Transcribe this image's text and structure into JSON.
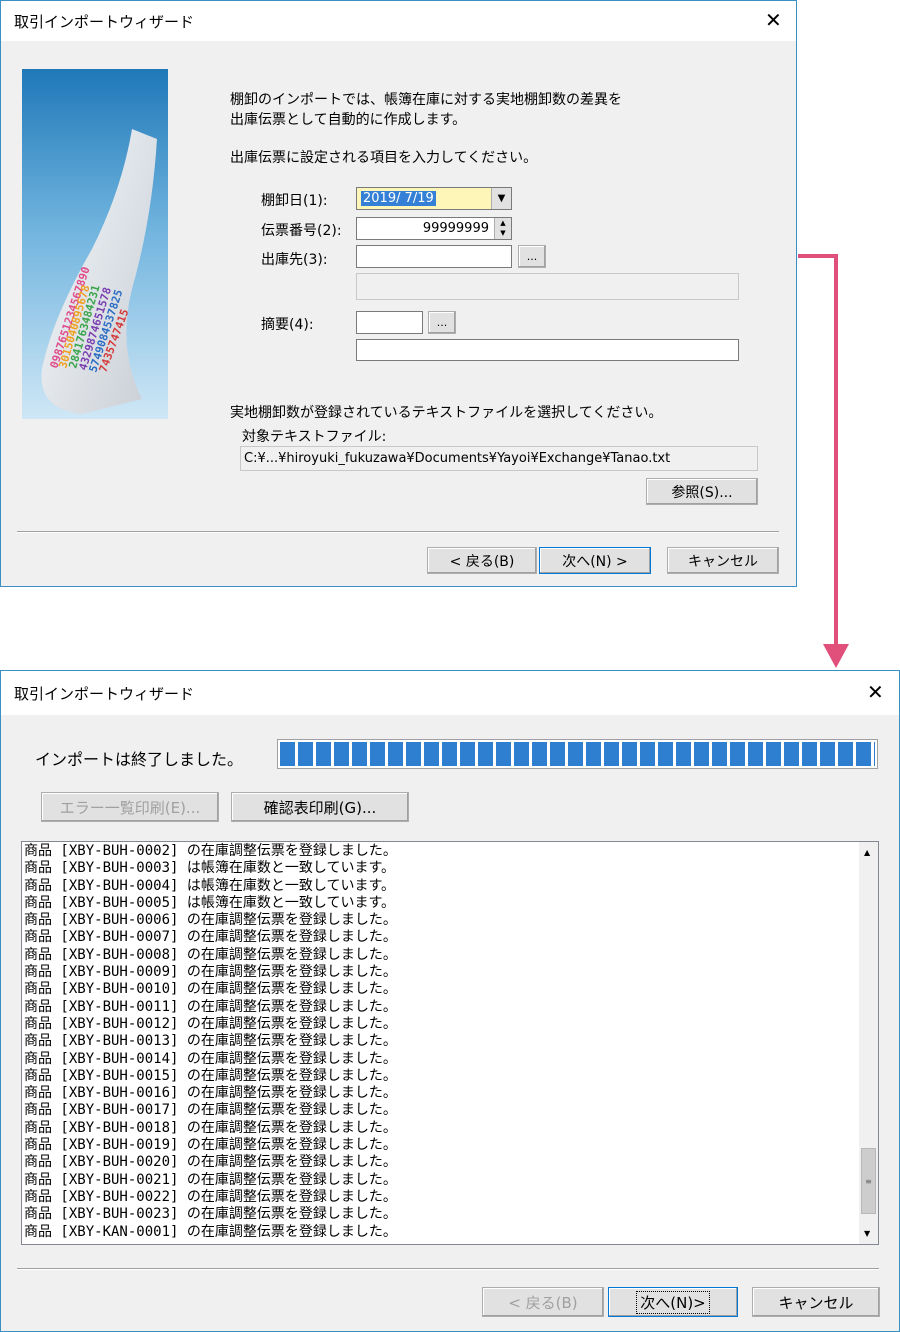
{
  "wizard1": {
    "title": "取引インポートウィザード",
    "intro_line1": "棚卸のインポートでは、帳簿在庫に対する実地棚卸数の差異を",
    "intro_line2": "出庫伝票として自動的に作成します。",
    "instruction": "出庫伝票に設定される項目を入力してください。",
    "date_label": "棚卸日(1):",
    "date_value": "2019/ 7/19",
    "slip_label": "伝票番号(2):",
    "slip_value": "99999999",
    "dest_label": "出庫先(3):",
    "dest_value": "",
    "memo_label": "摘要(4):",
    "memo_value": "",
    "browse_small": "...",
    "file_instruction": "実地棚卸数が登録されているテキストファイルを選択してください。",
    "file_label": "対象テキストファイル:",
    "file_path": "C:¥...¥hiroyuki_fukuzawa¥Documents¥Yayoi¥Exchange¥Tanao.txt",
    "browse_button": "参照(S)...",
    "back_button": "< 戻る(B)",
    "next_button": "次へ(N) >",
    "cancel_button": "キャンセル",
    "image_numbers": [
      "0987651234567890",
      "3015040895678",
      "2841763484231",
      "4329874651578",
      "5749084537825",
      "7435747415"
    ]
  },
  "wizard2": {
    "title": "取引インポートウィザード",
    "status_text": "インポートは終了しました。",
    "progress": 1.0,
    "error_print_button": "エラー一覧印刷(E)...",
    "confirm_print_button": "確認表印刷(G)...",
    "log_lines": [
      "商品 [XBY-BUH-0002] の在庫調整伝票を登録しました。",
      "商品 [XBY-BUH-0003] は帳簿在庫数と一致しています。",
      "商品 [XBY-BUH-0004] は帳簿在庫数と一致しています。",
      "商品 [XBY-BUH-0005] は帳簿在庫数と一致しています。",
      "商品 [XBY-BUH-0006] の在庫調整伝票を登録しました。",
      "商品 [XBY-BUH-0007] の在庫調整伝票を登録しました。",
      "商品 [XBY-BUH-0008] の在庫調整伝票を登録しました。",
      "商品 [XBY-BUH-0009] の在庫調整伝票を登録しました。",
      "商品 [XBY-BUH-0010] の在庫調整伝票を登録しました。",
      "商品 [XBY-BUH-0011] の在庫調整伝票を登録しました。",
      "商品 [XBY-BUH-0012] の在庫調整伝票を登録しました。",
      "商品 [XBY-BUH-0013] の在庫調整伝票を登録しました。",
      "商品 [XBY-BUH-0014] の在庫調整伝票を登録しました。",
      "商品 [XBY-BUH-0015] の在庫調整伝票を登録しました。",
      "商品 [XBY-BUH-0016] の在庫調整伝票を登録しました。",
      "商品 [XBY-BUH-0017] の在庫調整伝票を登録しました。",
      "商品 [XBY-BUH-0018] の在庫調整伝票を登録しました。",
      "商品 [XBY-BUH-0019] の在庫調整伝票を登録しました。",
      "商品 [XBY-BUH-0020] の在庫調整伝票を登録しました。",
      "商品 [XBY-BUH-0021] の在庫調整伝票を登録しました。",
      "商品 [XBY-BUH-0022] の在庫調整伝票を登録しました。",
      "商品 [XBY-BUH-0023] の在庫調整伝票を登録しました。",
      "商品 [XBY-KAN-0001] の在庫調整伝票を登録しました。"
    ],
    "back_button": "< 戻る(B)",
    "next_button": "次へ(N)>",
    "cancel_button": "キャンセル"
  },
  "colors": {
    "window_border": "#3a8fc4",
    "arrow": "#e0507a",
    "progress_block": "#2f7fd0",
    "date_highlight_bg": "#3380d6",
    "date_field_bg": "#fdf6b8"
  },
  "icons": {
    "close": "close-icon",
    "dropdown": "chevron-down-icon",
    "spin": "spin-arrows-icon",
    "scroll_up": "scroll-up-icon",
    "scroll_down": "scroll-down-icon"
  }
}
